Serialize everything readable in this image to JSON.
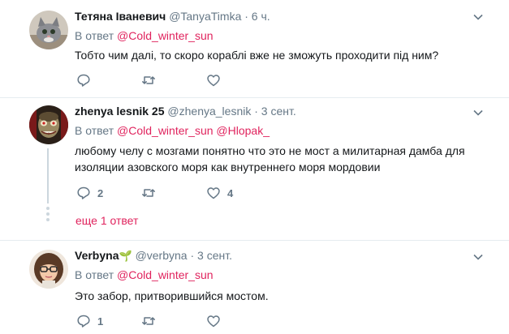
{
  "colors": {
    "accent": "#e0245e",
    "muted": "#657786",
    "text": "#14171a",
    "border": "#e6ecf0"
  },
  "tweets": [
    {
      "name": "Тетяна Іваневич",
      "handle": "@TanyaTimka",
      "time": "· 6 ч.",
      "reply_prefix": "В ответ",
      "reply_to": "@Cold_winter_sun",
      "reply_to_2": "",
      "text": "Тобто чим далі, то скоро кораблі вже не зможуть проходити під ним?",
      "reply_count": "",
      "retweet_count": "",
      "like_count": ""
    },
    {
      "name": "zhenya lesnik 25",
      "handle": "@zhenya_lesnik",
      "time": "· 3 сент.",
      "reply_prefix": "В ответ",
      "reply_to": "@Cold_winter_sun",
      "reply_to_2": "@Hlopak_",
      "text": "любому челу с мозгами понятно что это не мост а милитарная дамба для изоляции азовского моря как внутреннего моря мордовии",
      "reply_count": "2",
      "retweet_count": "",
      "like_count": "4"
    },
    {
      "name": "Verbyna",
      "name_emoji": "🌱",
      "handle": "@verbyna",
      "time": "· 3 сент.",
      "reply_prefix": "В ответ",
      "reply_to": "@Cold_winter_sun",
      "reply_to_2": "",
      "text": "Это забор, притворившийся мостом.",
      "reply_count": "1",
      "retweet_count": "",
      "like_count": ""
    }
  ],
  "more_replies": "еще 1 ответ",
  "icons": [
    "chevron-down-icon",
    "reply-icon",
    "retweet-icon",
    "like-icon"
  ]
}
